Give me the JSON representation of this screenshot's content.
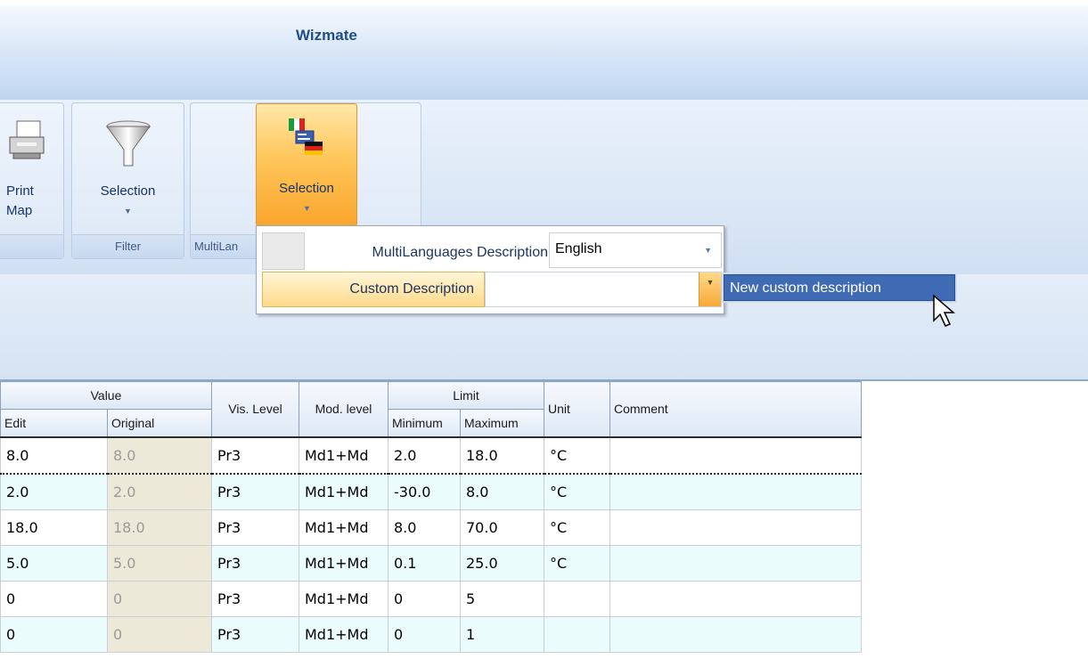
{
  "app": {
    "title": "Wizmate"
  },
  "ribbon": {
    "print_label": "Print",
    "print_label2": "Map",
    "filter_button_label": "Selection",
    "filter_group_caption": "Filter",
    "lang_button_label": "Selection",
    "lang_group_caption": "MultiLan"
  },
  "popup": {
    "row1_label": "MultiLanguages Description",
    "row1_value": "English",
    "row2_label": "Custom Description",
    "row2_value": "",
    "suggestion": "New custom description"
  },
  "grid": {
    "group_headers": {
      "value": "Value",
      "limit": "Limit"
    },
    "columns": {
      "edit": "Edit",
      "original": "Original",
      "vis_level": "Vis. Level",
      "mod_level": "Mod. level",
      "minimum": "Minimum",
      "maximum": "Maximum",
      "unit": "Unit",
      "comment": "Comment"
    },
    "rows": [
      {
        "edit": "8.0",
        "original": "8.0",
        "vis": "Pr3",
        "mod": "Md1+Md",
        "min": "2.0",
        "max": "18.0",
        "unit": "°C",
        "comment": ""
      },
      {
        "edit": "2.0",
        "original": "2.0",
        "vis": "Pr3",
        "mod": "Md1+Md",
        "min": "-30.0",
        "max": "8.0",
        "unit": "°C",
        "comment": ""
      },
      {
        "edit": "18.0",
        "original": "18.0",
        "vis": "Pr3",
        "mod": "Md1+Md",
        "min": "8.0",
        "max": "70.0",
        "unit": "°C",
        "comment": ""
      },
      {
        "edit": "5.0",
        "original": "5.0",
        "vis": "Pr3",
        "mod": "Md1+Md",
        "min": "0.1",
        "max": "25.0",
        "unit": "°C",
        "comment": ""
      },
      {
        "edit": "0",
        "original": "0",
        "vis": "Pr3",
        "mod": "Md1+Md",
        "min": "0",
        "max": "5",
        "unit": "",
        "comment": ""
      },
      {
        "edit": "0",
        "original": "0",
        "vis": "Pr3",
        "mod": "Md1+Md",
        "min": "0",
        "max": "1",
        "unit": "",
        "comment": ""
      }
    ]
  },
  "colors": {
    "accent_orange": "#fba52d",
    "selection_blue": "#3f6bb4",
    "row_alt": "#eafcfc"
  }
}
